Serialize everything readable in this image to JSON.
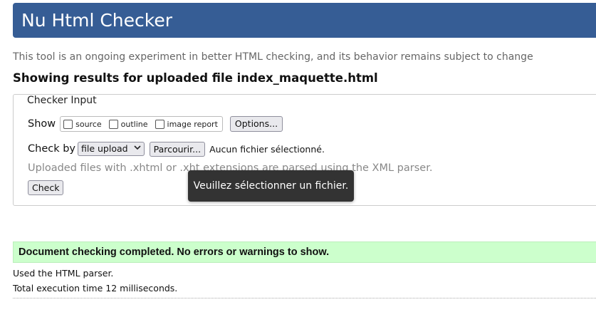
{
  "header": {
    "title": "Nu Html Checker"
  },
  "intro": "This tool is an ongoing experiment in better HTML checking, and its behavior remains subject to change",
  "results_title": "Showing results for uploaded file index_maquette.html",
  "checker_input": {
    "legend": "Checker Input",
    "show_label": "Show",
    "options": [
      {
        "label": "source",
        "checked": false
      },
      {
        "label": "outline",
        "checked": false
      },
      {
        "label": "image report",
        "checked": false
      }
    ],
    "options_button": "Options...",
    "check_by_label": "Check by",
    "check_by_value": "file upload",
    "browse_button": "Parcourir...",
    "no_file_text": "Aucun fichier sélectionné.",
    "note": "Uploaded files with .xhtml or .xht extensions are parsed using the XML parser.",
    "check_button": "Check"
  },
  "tooltip": "Veuillez sélectionner un fichier.",
  "success_message": "Document checking completed. No errors or warnings to show.",
  "details": {
    "parser": "Used the HTML parser.",
    "time": "Total execution time 12 milliseconds."
  }
}
